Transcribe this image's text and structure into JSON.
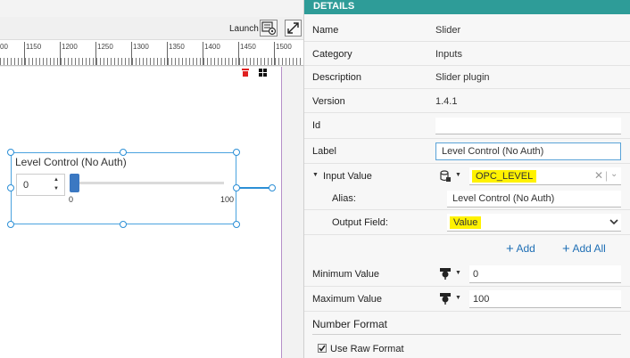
{
  "toolbar": {
    "launch_label": "Launch"
  },
  "ruler": {
    "ticks": [
      "00",
      "1150",
      "1200",
      "1250",
      "1300",
      "1350",
      "1400",
      "1450",
      "1500"
    ]
  },
  "widget": {
    "label": "Level Control (No Auth)",
    "input_value": "0",
    "slider_min": "0",
    "slider_max": "100",
    "slider_value": 0
  },
  "panel": {
    "header": "DETAILS",
    "name_label": "Name",
    "name_value": "Slider",
    "category_label": "Category",
    "category_value": "Inputs",
    "description_label": "Description",
    "description_value": "Slider plugin",
    "version_label": "Version",
    "version_value": "1.4.1",
    "id_label": "Id",
    "id_value": "",
    "label_label": "Label",
    "label_value": "Level Control (No Auth)",
    "input_value_label": "Input Value",
    "input_value_value": "OPC_LEVEL",
    "alias_label": "Alias:",
    "alias_value": "Level Control (No Auth)",
    "output_field_label": "Output Field:",
    "output_field_value": "Value",
    "add_label": "Add",
    "add_all_label": "Add All",
    "min_label": "Minimum Value",
    "min_value": "0",
    "max_label": "Maximum Value",
    "max_value": "100",
    "number_format_label": "Number Format",
    "raw_format_label": "Use Raw Format",
    "raw_format_checked": true
  },
  "colors": {
    "accent": "#2e9c98",
    "selection": "#2c8fd6",
    "highlight": "#fff200",
    "thumb": "#3b78c2"
  }
}
